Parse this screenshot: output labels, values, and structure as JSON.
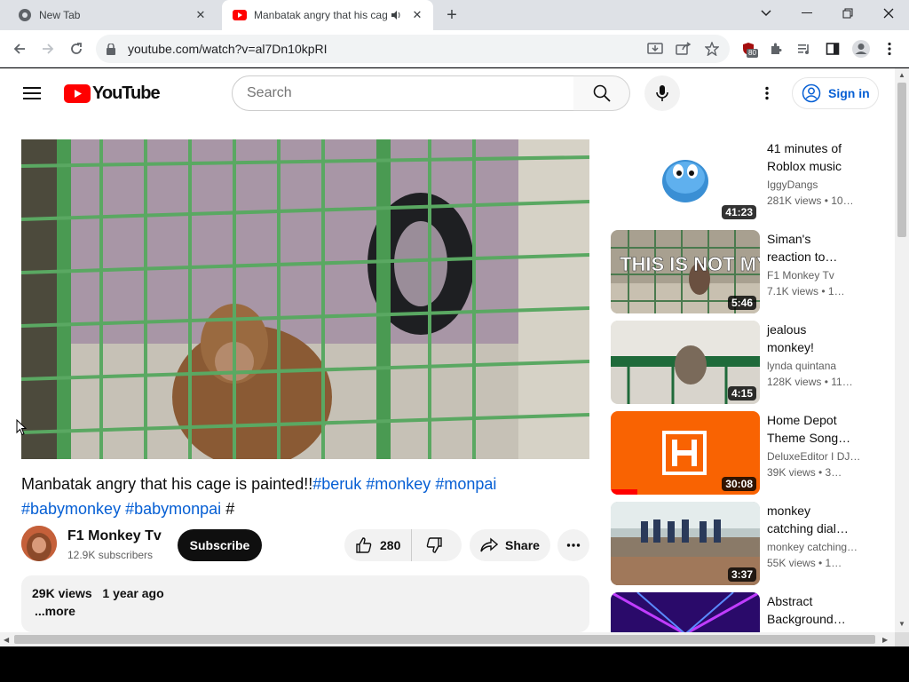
{
  "browser": {
    "tabs": [
      {
        "title": "New Tab",
        "active": false
      },
      {
        "title": "Manbatak angry that his cag",
        "active": true
      }
    ],
    "url": "youtube.com/watch?v=al7Dn10kpRI",
    "extension_badge": "80"
  },
  "youtube": {
    "logo_text": "YouTube",
    "search_placeholder": "Search",
    "signin_label": "Sign in",
    "video": {
      "title_text": "Manbatak angry that his cage is painted!!",
      "hashtags": [
        "#beruk",
        "#monkey",
        "#monpai",
        "#babymonkey",
        "#babymonpai"
      ],
      "trailing": "#",
      "channel_name": "F1 Monkey Tv",
      "subscribers": "12.9K subscribers",
      "subscribe_label": "Subscribe",
      "likes": "280",
      "share_label": "Share",
      "views": "29K views",
      "age": "1 year ago",
      "more_label": "...more"
    },
    "recommendations": [
      {
        "title_line1": "41 minutes of",
        "title_line2": "Roblox music",
        "channel": "IggyDangs",
        "stats": "281K views  • 10…",
        "duration": "41:23"
      },
      {
        "title_line1": "Siman's",
        "title_line2": "reaction to…",
        "channel": "F1 Monkey Tv",
        "stats": "7.1K views  • 1…",
        "duration": "5:46",
        "thumb_text": "THIS IS NOT MY SON!"
      },
      {
        "title_line1": "jealous",
        "title_line2": "monkey!",
        "channel": "lynda quintana",
        "stats": "128K views  • 11…",
        "duration": "4:15"
      },
      {
        "title_line1": "Home Depot",
        "title_line2": "Theme Song…",
        "channel": "DeluxeEditor I DJ…",
        "stats": "39K views  • 3…",
        "duration": "30:08"
      },
      {
        "title_line1": "monkey",
        "title_line2": "catching dial…",
        "channel": "monkey catching…",
        "stats": "55K views  • 1…",
        "duration": "3:37"
      },
      {
        "title_line1": "Abstract",
        "title_line2": "Background…",
        "channel": "",
        "stats": "",
        "duration": ""
      }
    ]
  },
  "colors": {
    "accent_red": "#ff0000",
    "link_blue": "#065fd4",
    "home_depot_orange": "#f96302"
  }
}
